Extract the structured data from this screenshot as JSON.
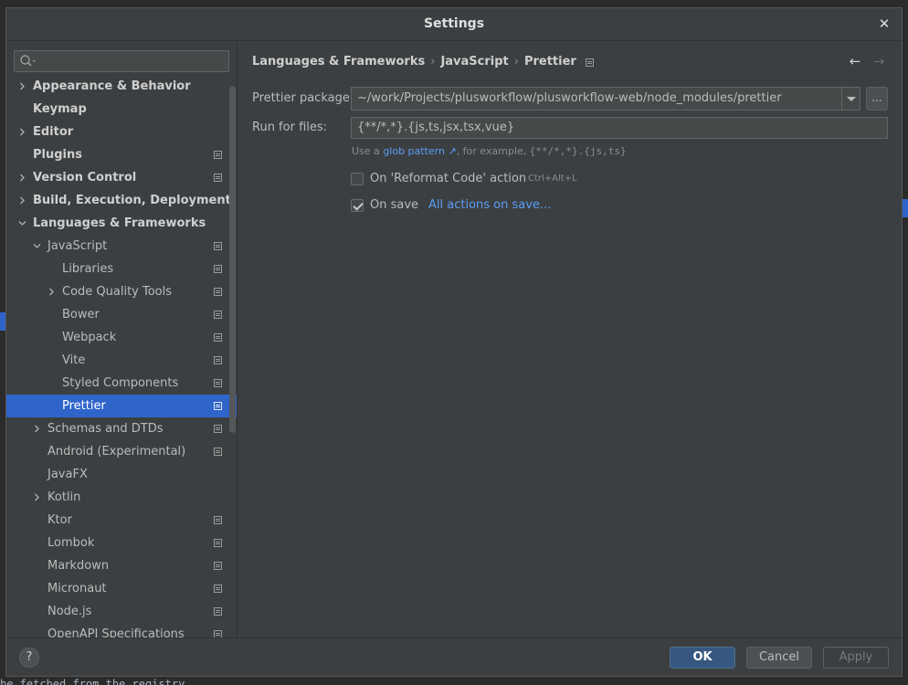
{
  "window": {
    "title": "Settings"
  },
  "background": {
    "bottom_text": "be fetched from the registry"
  },
  "sidebar": {
    "search_placeholder": "",
    "items": [
      {
        "label": "Appearance & Behavior",
        "bold": true,
        "level": 0,
        "expander": "collapsed",
        "project_icon": false
      },
      {
        "label": "Keymap",
        "bold": true,
        "level": 0,
        "expander": "none",
        "project_icon": false
      },
      {
        "label": "Editor",
        "bold": true,
        "level": 0,
        "expander": "collapsed",
        "project_icon": false
      },
      {
        "label": "Plugins",
        "bold": true,
        "level": 0,
        "expander": "none",
        "project_icon": true
      },
      {
        "label": "Version Control",
        "bold": true,
        "level": 0,
        "expander": "collapsed",
        "project_icon": true
      },
      {
        "label": "Build, Execution, Deployment",
        "bold": true,
        "level": 0,
        "expander": "collapsed",
        "project_icon": false
      },
      {
        "label": "Languages & Frameworks",
        "bold": true,
        "level": 0,
        "expander": "expanded",
        "project_icon": false
      },
      {
        "label": "JavaScript",
        "bold": false,
        "level": 1,
        "expander": "expanded",
        "project_icon": true
      },
      {
        "label": "Libraries",
        "bold": false,
        "level": 2,
        "expander": "none",
        "project_icon": true
      },
      {
        "label": "Code Quality Tools",
        "bold": false,
        "level": 2,
        "expander": "collapsed",
        "project_icon": true
      },
      {
        "label": "Bower",
        "bold": false,
        "level": 2,
        "expander": "none",
        "project_icon": true
      },
      {
        "label": "Webpack",
        "bold": false,
        "level": 2,
        "expander": "none",
        "project_icon": true
      },
      {
        "label": "Vite",
        "bold": false,
        "level": 2,
        "expander": "none",
        "project_icon": true
      },
      {
        "label": "Styled Components",
        "bold": false,
        "level": 2,
        "expander": "none",
        "project_icon": true
      },
      {
        "label": "Prettier",
        "bold": false,
        "level": 2,
        "expander": "none",
        "project_icon": true,
        "selected": true
      },
      {
        "label": "Schemas and DTDs",
        "bold": false,
        "level": 1,
        "expander": "collapsed",
        "project_icon": true
      },
      {
        "label": "Android (Experimental)",
        "bold": false,
        "level": 1,
        "expander": "none",
        "project_icon": true
      },
      {
        "label": "JavaFX",
        "bold": false,
        "level": 1,
        "expander": "none",
        "project_icon": false
      },
      {
        "label": "Kotlin",
        "bold": false,
        "level": 1,
        "expander": "collapsed",
        "project_icon": false
      },
      {
        "label": "Ktor",
        "bold": false,
        "level": 1,
        "expander": "none",
        "project_icon": true
      },
      {
        "label": "Lombok",
        "bold": false,
        "level": 1,
        "expander": "none",
        "project_icon": true
      },
      {
        "label": "Markdown",
        "bold": false,
        "level": 1,
        "expander": "none",
        "project_icon": true
      },
      {
        "label": "Micronaut",
        "bold": false,
        "level": 1,
        "expander": "none",
        "project_icon": true
      },
      {
        "label": "Node.js",
        "bold": false,
        "level": 1,
        "expander": "none",
        "project_icon": true
      },
      {
        "label": "OpenAPI Specifications",
        "bold": false,
        "level": 1,
        "expander": "none",
        "project_icon": true
      }
    ]
  },
  "breadcrumb": {
    "items": [
      "Languages & Frameworks",
      "JavaScript",
      "Prettier"
    ],
    "separator": "›"
  },
  "nav": {
    "back": "←",
    "forward": "→"
  },
  "form": {
    "package_label": "Prettier package:",
    "package_value": "~/work/Projects/plusworkflow/plusworkflow-web/node_modules/prettier",
    "browse_label": "...",
    "run_for_label": "Run for files:",
    "run_for_value": "{**/*,*}.{js,ts,jsx,tsx,vue}",
    "hint_prefix": "Use a",
    "hint_link": "glob pattern ↗",
    "hint_middle": ", for example,",
    "hint_example": "{**/*,*}.{js,ts}",
    "reformat_label": "On 'Reformat Code' action",
    "reformat_checked": false,
    "reformat_shortcut": "Ctrl+Alt+L",
    "on_save_label": "On save",
    "on_save_checked": true,
    "all_actions_link": "All actions on save..."
  },
  "footer": {
    "help": "?",
    "ok": "OK",
    "cancel": "Cancel",
    "apply": "Apply"
  },
  "colors": {
    "accent": "#2f65ca",
    "link": "#589df6",
    "background": "#3c3f41"
  }
}
